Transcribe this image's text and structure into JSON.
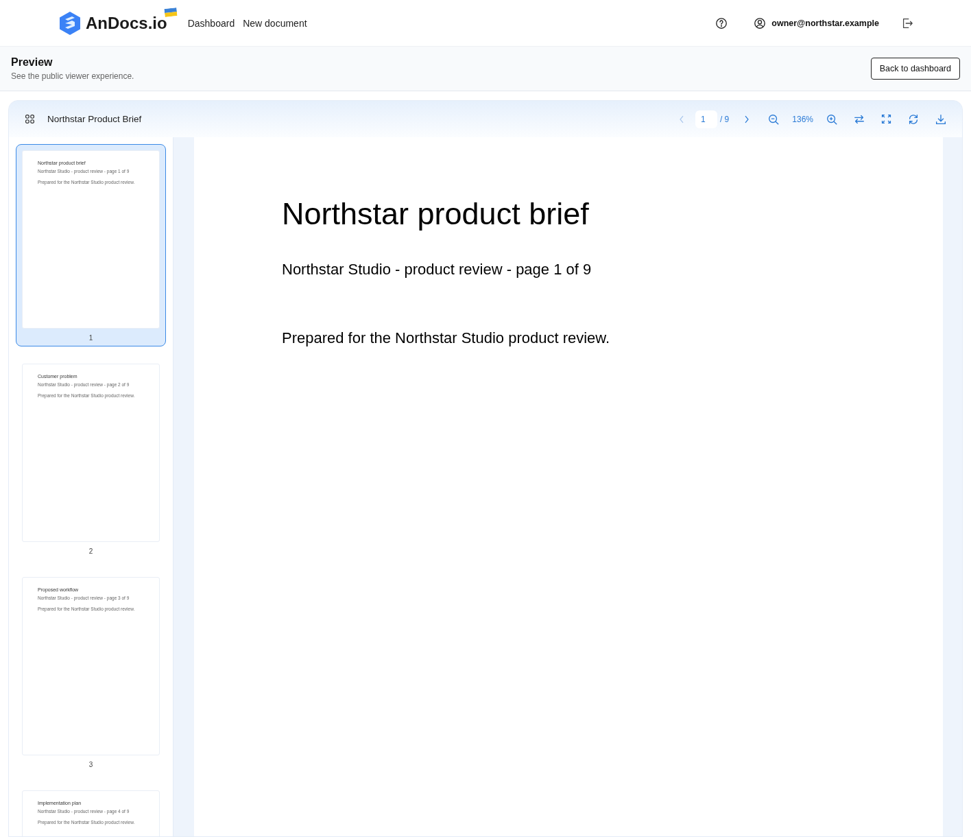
{
  "header": {
    "brand": "AnDocs.io",
    "nav": [
      {
        "label": "Dashboard"
      },
      {
        "label": "New document"
      }
    ],
    "user": "owner@northstar.example"
  },
  "page_header": {
    "title": "Preview",
    "subtitle": "See the public viewer experience.",
    "button": "Back to dashboard"
  },
  "viewer": {
    "title": "Northstar Product Brief",
    "page_input": "1",
    "page_total": "/ 9",
    "zoom": "136%",
    "thumbnails": [
      {
        "title": "Northstar product brief",
        "line_1": "Northstar Studio - product review - page 1 of 9",
        "line_2": "Prepared for the Northstar Studio product review.",
        "number": "1",
        "selected": true
      },
      {
        "title": "Customer problem",
        "line_1": "Northstar Studio - product review - page 2 of 9",
        "line_2": "Prepared for the Northstar Studio product review.",
        "number": "2",
        "selected": false
      },
      {
        "title": "Proposed workflow",
        "line_1": "Northstar Studio - product review - page 3 of 9",
        "line_2": "Prepared for the Northstar Studio product review.",
        "number": "3",
        "selected": false
      },
      {
        "title": "Implementation plan",
        "line_1": "Northstar Studio - product review - page 4 of 9",
        "line_2": "Prepared for the Northstar Studio product review.",
        "selected": false
      }
    ],
    "page": {
      "title": "Northstar product brief",
      "subtitle": "Northstar Studio - product review - page 1 of 9",
      "body": "Prepared for the Northstar Studio product review."
    }
  }
}
